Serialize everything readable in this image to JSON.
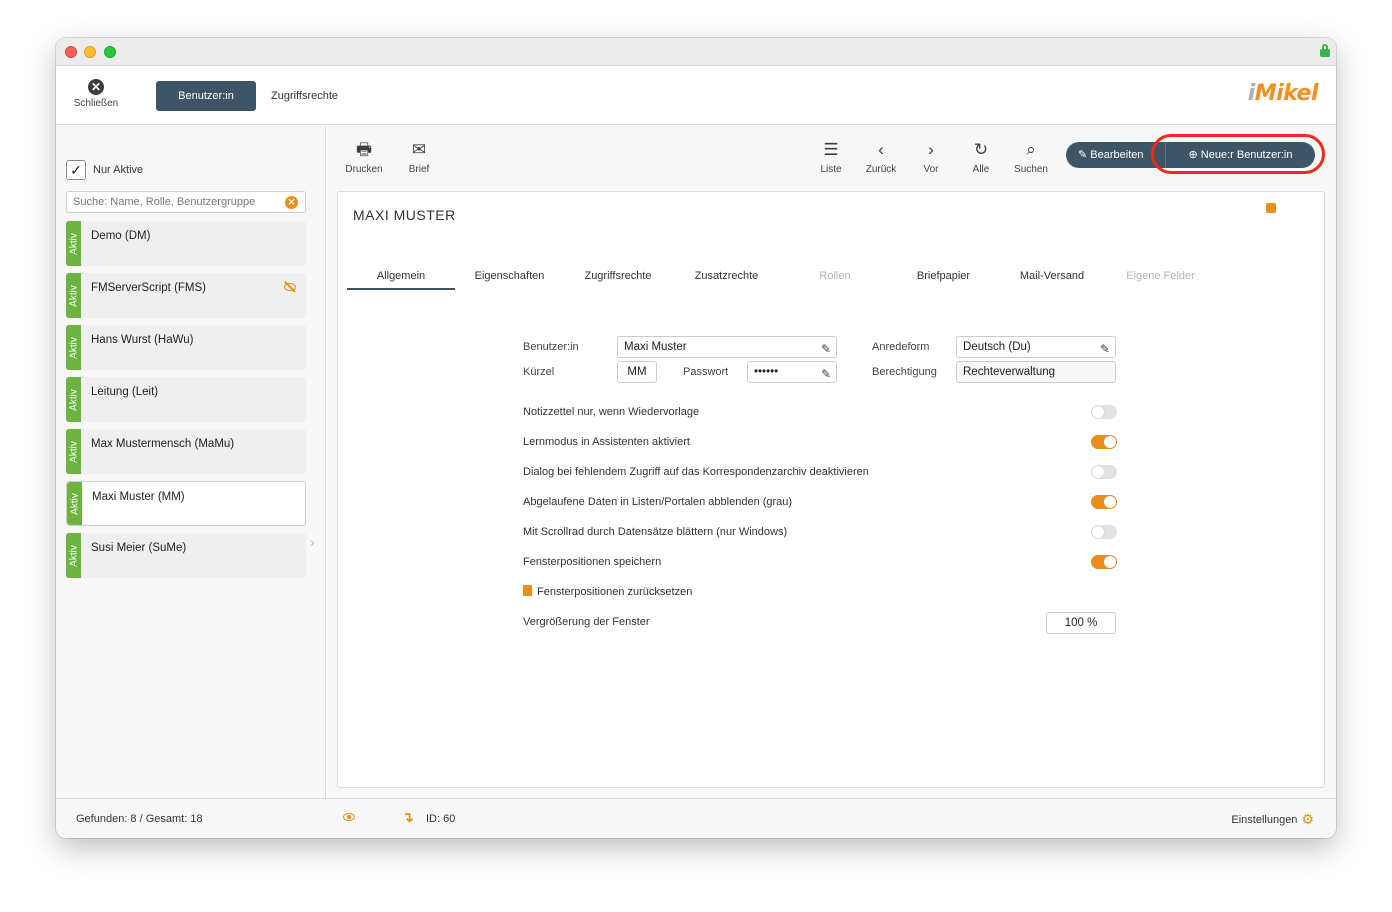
{
  "topbar": {
    "close_label": "Schließen",
    "tab_users": "Benutzer:in",
    "tab_access": "Zugriffsrechte",
    "logo_i": "i",
    "logo_text": "Mikel"
  },
  "sidebar": {
    "only_active_label": "Nur Aktive",
    "only_active_checked": true,
    "search_placeholder": "Suche: Name, Rolle, Benutzergruppe",
    "status_label": "Aktiv",
    "users": [
      {
        "name": "Demo (DM)",
        "hidden": false,
        "selected": false
      },
      {
        "name": "FMServerScript (FMS)",
        "hidden": true,
        "selected": false
      },
      {
        "name": "Hans Wurst (HaWu)",
        "hidden": false,
        "selected": false
      },
      {
        "name": "Leitung (Leit)",
        "hidden": false,
        "selected": false
      },
      {
        "name": "Max Mustermensch (MaMu)",
        "hidden": false,
        "selected": false
      },
      {
        "name": "Maxi Muster (MM)",
        "hidden": false,
        "selected": true
      },
      {
        "name": "Susi Meier (SuMe)",
        "hidden": false,
        "selected": false
      }
    ]
  },
  "toolbar": {
    "print": "Drucken",
    "letter": "Brief",
    "list": "Liste",
    "back": "Zurück",
    "next": "Vor",
    "all": "Alle",
    "search": "Suchen",
    "edit": "Bearbeiten",
    "new_user": "Neue:r Benutzer:in"
  },
  "record": {
    "title": "MAXI MUSTER",
    "tabs": [
      {
        "label": "Allgemein",
        "state": "active"
      },
      {
        "label": "Eigenschaften",
        "state": "normal"
      },
      {
        "label": "Zugriffsrechte",
        "state": "normal"
      },
      {
        "label": "Zusatzrechte",
        "state": "normal"
      },
      {
        "label": "Rollen",
        "state": "disabled"
      },
      {
        "label": "Briefpapier",
        "state": "normal"
      },
      {
        "label": "Mail-Versand",
        "state": "normal"
      },
      {
        "label": "Eigene Felder",
        "state": "disabled"
      }
    ],
    "fields": {
      "user_label": "Benutzer:in",
      "user_value": "Maxi Muster",
      "salutation_label": "Anredeform",
      "salutation_value": "Deutsch (Du)",
      "short_label": "Kürzel",
      "short_value": "MM",
      "password_label": "Passwort",
      "password_value": "••••••",
      "permission_label": "Berechtigung",
      "permission_value": "Rechteverwaltung"
    },
    "toggles": [
      {
        "label": "Notizzettel nur, wenn Wiedervorlage",
        "on": false
      },
      {
        "label": "Lernmodus in Assistenten aktiviert",
        "on": true
      },
      {
        "label": "Dialog bei fehlendem Zugriff auf das Korrespondenzarchiv deaktivieren",
        "on": false
      },
      {
        "label": "Abgelaufene Daten in Listen/Portalen abblenden (grau)",
        "on": true
      },
      {
        "label": "Mit Scrollrad durch Datensätze blättern (nur Windows)",
        "on": false
      },
      {
        "label": "Fensterpositionen speichern",
        "on": true
      }
    ],
    "reset_positions": "Fensterpositionen zurücksetzen",
    "zoom_label": "Vergrößerung der Fenster",
    "zoom_value": "100 %"
  },
  "status": {
    "found": "Gefunden: 8 / Gesamt: 18",
    "id": "ID: 60",
    "settings": "Einstellungen"
  },
  "colors": {
    "accent": "#e9901c",
    "primary": "#3d5566",
    "active_green": "#6ab43f",
    "highlight": "#ee2a1a"
  }
}
